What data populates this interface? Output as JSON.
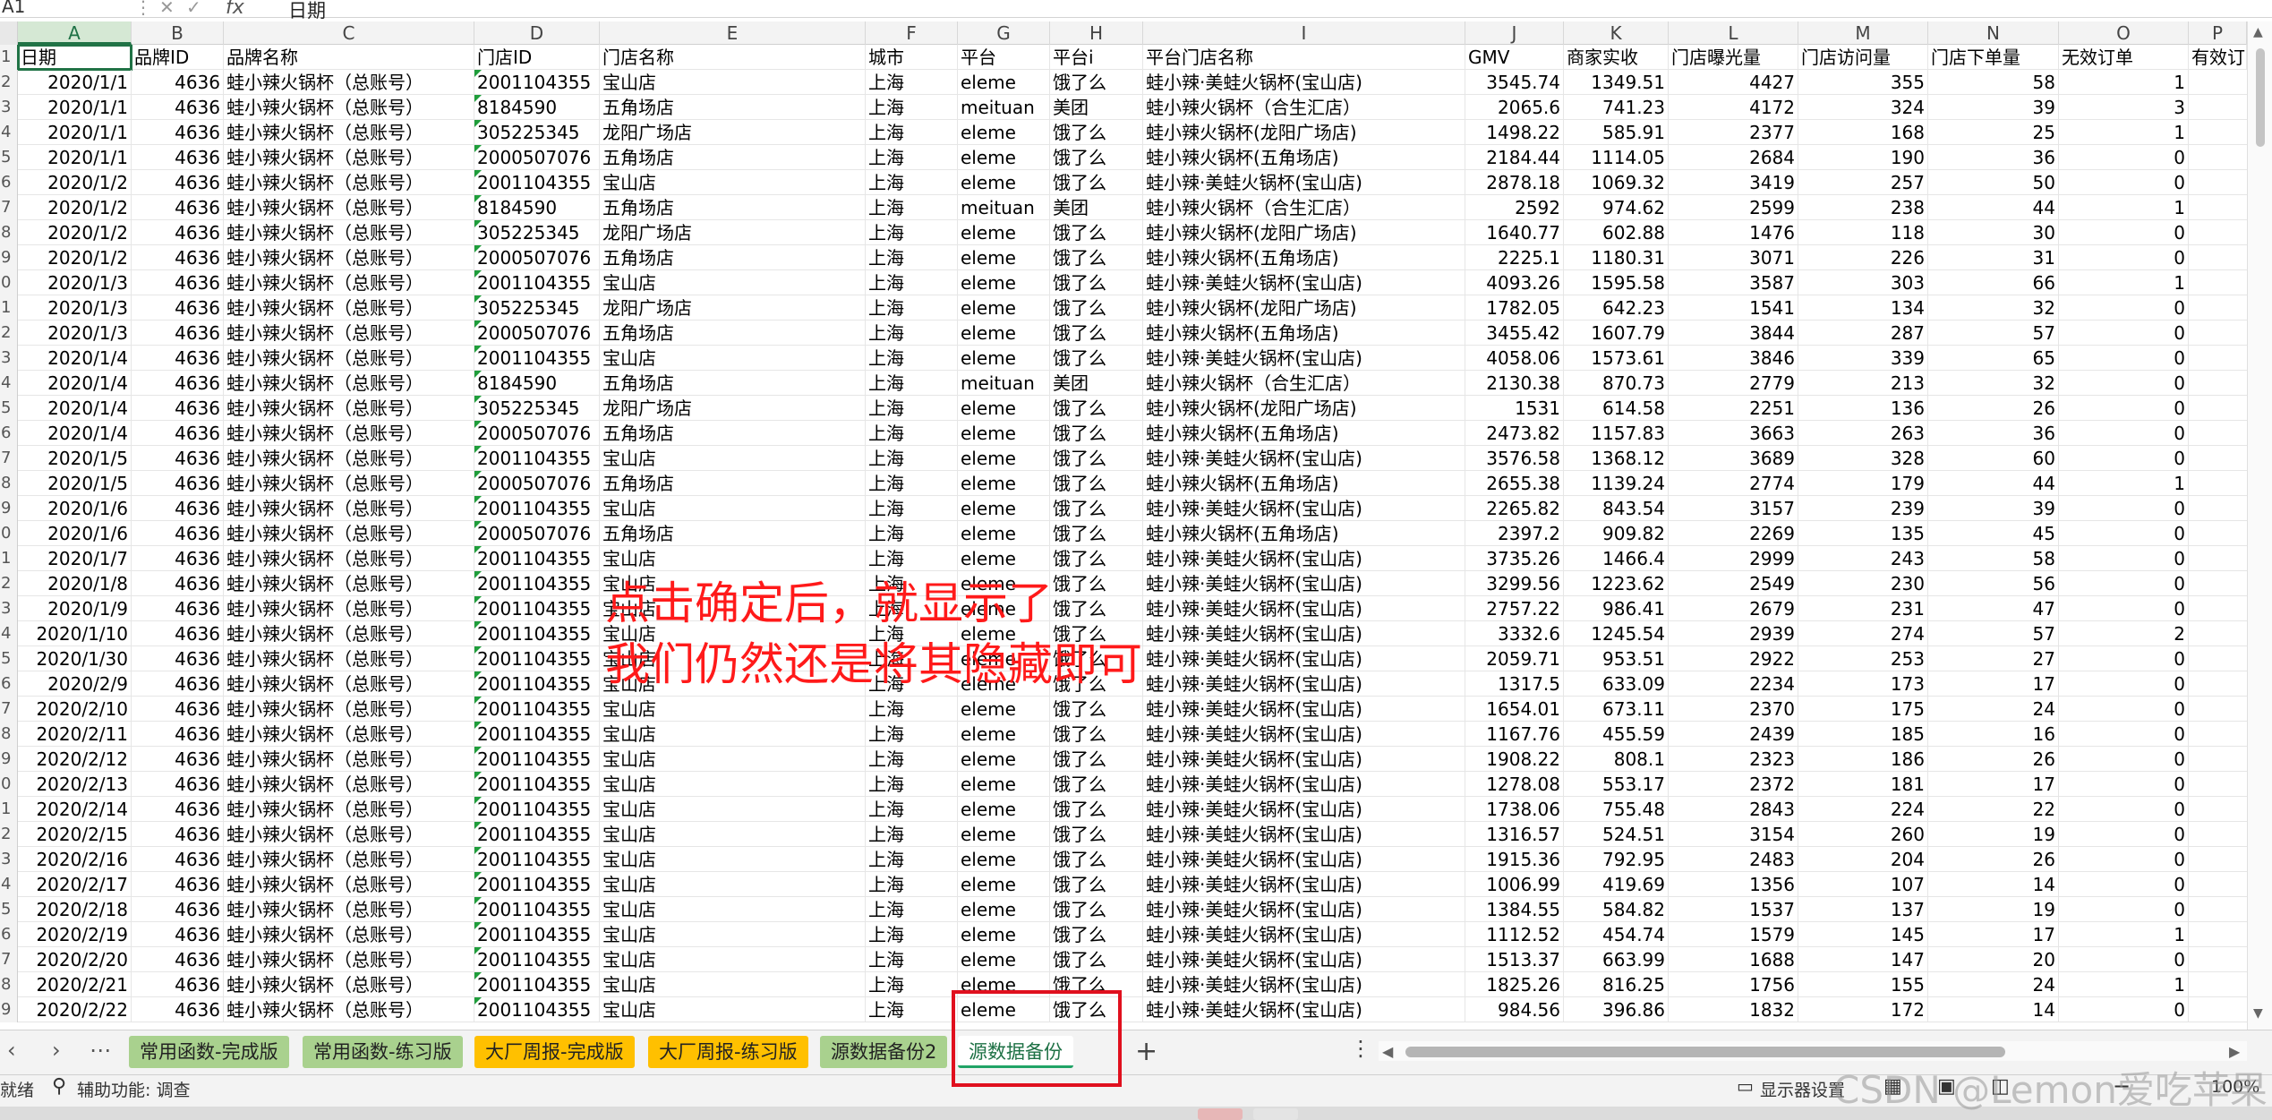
{
  "formula_bar": {
    "name_box": "A1",
    "fx": "fx",
    "content": "日期"
  },
  "columns": [
    {
      "letter": "A",
      "header": "日期"
    },
    {
      "letter": "B",
      "header": "品牌ID"
    },
    {
      "letter": "C",
      "header": "品牌名称"
    },
    {
      "letter": "D",
      "header": "门店ID"
    },
    {
      "letter": "E",
      "header": "门店名称"
    },
    {
      "letter": "F",
      "header": "城市"
    },
    {
      "letter": "G",
      "header": "平台"
    },
    {
      "letter": "H",
      "header": "平台i"
    },
    {
      "letter": "I",
      "header": "平台门店名称"
    },
    {
      "letter": "J",
      "header": "GMV"
    },
    {
      "letter": "K",
      "header": "商家实收"
    },
    {
      "letter": "L",
      "header": "门店曝光量"
    },
    {
      "letter": "M",
      "header": "门店访问量"
    },
    {
      "letter": "N",
      "header": "门店下单量"
    },
    {
      "letter": "O",
      "header": "无效订单"
    },
    {
      "letter": "P",
      "header": "有效订"
    }
  ],
  "row_numbers": [
    "1",
    "2",
    "3",
    "4",
    "5",
    "6",
    "7",
    "8",
    "9",
    "0",
    "1",
    "2",
    "3",
    "4",
    "5",
    "6",
    "7",
    "8",
    "9",
    "0",
    "1",
    "2",
    "3",
    "4",
    "5",
    "6",
    "7",
    "8",
    "9",
    "0",
    "1",
    "2",
    "3",
    "4",
    "5",
    "6",
    "7",
    "8",
    "9"
  ],
  "rows": [
    [
      "2020/1/1",
      "4636",
      "蛙小辣火锅杯（总账号）",
      "2001104355",
      "宝山店",
      "上海",
      "eleme",
      "饿了么",
      "蛙小辣·美蛙火锅杯(宝山店)",
      "3545.74",
      "1349.51",
      "4427",
      "355",
      "58",
      "1"
    ],
    [
      "2020/1/1",
      "4636",
      "蛙小辣火锅杯（总账号）",
      "8184590",
      "五角场店",
      "上海",
      "meituan",
      "美团",
      "蛙小辣火锅杯（合生汇店）",
      "2065.6",
      "741.23",
      "4172",
      "324",
      "39",
      "3"
    ],
    [
      "2020/1/1",
      "4636",
      "蛙小辣火锅杯（总账号）",
      "305225345",
      "龙阳广场店",
      "上海",
      "eleme",
      "饿了么",
      "蛙小辣火锅杯(龙阳广场店)",
      "1498.22",
      "585.91",
      "2377",
      "168",
      "25",
      "1"
    ],
    [
      "2020/1/1",
      "4636",
      "蛙小辣火锅杯（总账号）",
      "2000507076",
      "五角场店",
      "上海",
      "eleme",
      "饿了么",
      "蛙小辣火锅杯(五角场店)",
      "2184.44",
      "1114.05",
      "2684",
      "190",
      "36",
      "0"
    ],
    [
      "2020/1/2",
      "4636",
      "蛙小辣火锅杯（总账号）",
      "2001104355",
      "宝山店",
      "上海",
      "eleme",
      "饿了么",
      "蛙小辣·美蛙火锅杯(宝山店)",
      "2878.18",
      "1069.32",
      "3419",
      "257",
      "50",
      "0"
    ],
    [
      "2020/1/2",
      "4636",
      "蛙小辣火锅杯（总账号）",
      "8184590",
      "五角场店",
      "上海",
      "meituan",
      "美团",
      "蛙小辣火锅杯（合生汇店）",
      "2592",
      "974.62",
      "2599",
      "238",
      "44",
      "1"
    ],
    [
      "2020/1/2",
      "4636",
      "蛙小辣火锅杯（总账号）",
      "305225345",
      "龙阳广场店",
      "上海",
      "eleme",
      "饿了么",
      "蛙小辣火锅杯(龙阳广场店)",
      "1640.77",
      "602.88",
      "1476",
      "118",
      "30",
      "0"
    ],
    [
      "2020/1/2",
      "4636",
      "蛙小辣火锅杯（总账号）",
      "2000507076",
      "五角场店",
      "上海",
      "eleme",
      "饿了么",
      "蛙小辣火锅杯(五角场店)",
      "2225.1",
      "1180.31",
      "3071",
      "226",
      "31",
      "0"
    ],
    [
      "2020/1/3",
      "4636",
      "蛙小辣火锅杯（总账号）",
      "2001104355",
      "宝山店",
      "上海",
      "eleme",
      "饿了么",
      "蛙小辣·美蛙火锅杯(宝山店)",
      "4093.26",
      "1595.58",
      "3587",
      "303",
      "66",
      "1"
    ],
    [
      "2020/1/3",
      "4636",
      "蛙小辣火锅杯（总账号）",
      "305225345",
      "龙阳广场店",
      "上海",
      "eleme",
      "饿了么",
      "蛙小辣火锅杯(龙阳广场店)",
      "1782.05",
      "642.23",
      "1541",
      "134",
      "32",
      "0"
    ],
    [
      "2020/1/3",
      "4636",
      "蛙小辣火锅杯（总账号）",
      "2000507076",
      "五角场店",
      "上海",
      "eleme",
      "饿了么",
      "蛙小辣火锅杯(五角场店)",
      "3455.42",
      "1607.79",
      "3844",
      "287",
      "57",
      "0"
    ],
    [
      "2020/1/4",
      "4636",
      "蛙小辣火锅杯（总账号）",
      "2001104355",
      "宝山店",
      "上海",
      "eleme",
      "饿了么",
      "蛙小辣·美蛙火锅杯(宝山店)",
      "4058.06",
      "1573.61",
      "3846",
      "339",
      "65",
      "0"
    ],
    [
      "2020/1/4",
      "4636",
      "蛙小辣火锅杯（总账号）",
      "8184590",
      "五角场店",
      "上海",
      "meituan",
      "美团",
      "蛙小辣火锅杯（合生汇店）",
      "2130.38",
      "870.73",
      "2779",
      "213",
      "32",
      "0"
    ],
    [
      "2020/1/4",
      "4636",
      "蛙小辣火锅杯（总账号）",
      "305225345",
      "龙阳广场店",
      "上海",
      "eleme",
      "饿了么",
      "蛙小辣火锅杯(龙阳广场店)",
      "1531",
      "614.58",
      "2251",
      "136",
      "26",
      "0"
    ],
    [
      "2020/1/4",
      "4636",
      "蛙小辣火锅杯（总账号）",
      "2000507076",
      "五角场店",
      "上海",
      "eleme",
      "饿了么",
      "蛙小辣火锅杯(五角场店)",
      "2473.82",
      "1157.83",
      "3663",
      "263",
      "36",
      "0"
    ],
    [
      "2020/1/5",
      "4636",
      "蛙小辣火锅杯（总账号）",
      "2001104355",
      "宝山店",
      "上海",
      "eleme",
      "饿了么",
      "蛙小辣·美蛙火锅杯(宝山店)",
      "3576.58",
      "1368.12",
      "3689",
      "328",
      "60",
      "0"
    ],
    [
      "2020/1/5",
      "4636",
      "蛙小辣火锅杯（总账号）",
      "2000507076",
      "五角场店",
      "上海",
      "eleme",
      "饿了么",
      "蛙小辣火锅杯(五角场店)",
      "2655.38",
      "1139.24",
      "2774",
      "179",
      "44",
      "1"
    ],
    [
      "2020/1/6",
      "4636",
      "蛙小辣火锅杯（总账号）",
      "2001104355",
      "宝山店",
      "上海",
      "eleme",
      "饿了么",
      "蛙小辣·美蛙火锅杯(宝山店)",
      "2265.82",
      "843.54",
      "3157",
      "239",
      "39",
      "0"
    ],
    [
      "2020/1/6",
      "4636",
      "蛙小辣火锅杯（总账号）",
      "2000507076",
      "五角场店",
      "上海",
      "eleme",
      "饿了么",
      "蛙小辣火锅杯(五角场店)",
      "2397.2",
      "909.82",
      "2269",
      "135",
      "45",
      "0"
    ],
    [
      "2020/1/7",
      "4636",
      "蛙小辣火锅杯（总账号）",
      "2001104355",
      "宝山店",
      "上海",
      "eleme",
      "饿了么",
      "蛙小辣·美蛙火锅杯(宝山店)",
      "3735.26",
      "1466.4",
      "2999",
      "243",
      "58",
      "0"
    ],
    [
      "2020/1/8",
      "4636",
      "蛙小辣火锅杯（总账号）",
      "2001104355",
      "宝山店",
      "上海",
      "eleme",
      "饿了么",
      "蛙小辣·美蛙火锅杯(宝山店)",
      "3299.56",
      "1223.62",
      "2549",
      "230",
      "56",
      "0"
    ],
    [
      "2020/1/9",
      "4636",
      "蛙小辣火锅杯（总账号）",
      "2001104355",
      "宝山店",
      "上海",
      "eleme",
      "饿了么",
      "蛙小辣·美蛙火锅杯(宝山店)",
      "2757.22",
      "986.41",
      "2679",
      "231",
      "47",
      "0"
    ],
    [
      "2020/1/10",
      "4636",
      "蛙小辣火锅杯（总账号）",
      "2001104355",
      "宝山店",
      "上海",
      "eleme",
      "饿了么",
      "蛙小辣·美蛙火锅杯(宝山店)",
      "3332.6",
      "1245.54",
      "2939",
      "274",
      "57",
      "2"
    ],
    [
      "2020/1/30",
      "4636",
      "蛙小辣火锅杯（总账号）",
      "2001104355",
      "宝山店",
      "上海",
      "eleme",
      "饿了么",
      "蛙小辣·美蛙火锅杯(宝山店)",
      "2059.71",
      "953.51",
      "2922",
      "253",
      "27",
      "0"
    ],
    [
      "2020/2/9",
      "4636",
      "蛙小辣火锅杯（总账号）",
      "2001104355",
      "宝山店",
      "上海",
      "eleme",
      "饿了么",
      "蛙小辣·美蛙火锅杯(宝山店)",
      "1317.5",
      "633.09",
      "2234",
      "173",
      "17",
      "0"
    ],
    [
      "2020/2/10",
      "4636",
      "蛙小辣火锅杯（总账号）",
      "2001104355",
      "宝山店",
      "上海",
      "eleme",
      "饿了么",
      "蛙小辣·美蛙火锅杯(宝山店)",
      "1654.01",
      "673.11",
      "2370",
      "175",
      "24",
      "0"
    ],
    [
      "2020/2/11",
      "4636",
      "蛙小辣火锅杯（总账号）",
      "2001104355",
      "宝山店",
      "上海",
      "eleme",
      "饿了么",
      "蛙小辣·美蛙火锅杯(宝山店)",
      "1167.76",
      "455.59",
      "2439",
      "185",
      "16",
      "0"
    ],
    [
      "2020/2/12",
      "4636",
      "蛙小辣火锅杯（总账号）",
      "2001104355",
      "宝山店",
      "上海",
      "eleme",
      "饿了么",
      "蛙小辣·美蛙火锅杯(宝山店)",
      "1908.22",
      "808.1",
      "2323",
      "186",
      "26",
      "0"
    ],
    [
      "2020/2/13",
      "4636",
      "蛙小辣火锅杯（总账号）",
      "2001104355",
      "宝山店",
      "上海",
      "eleme",
      "饿了么",
      "蛙小辣·美蛙火锅杯(宝山店)",
      "1278.08",
      "553.17",
      "2372",
      "181",
      "17",
      "0"
    ],
    [
      "2020/2/14",
      "4636",
      "蛙小辣火锅杯（总账号）",
      "2001104355",
      "宝山店",
      "上海",
      "eleme",
      "饿了么",
      "蛙小辣·美蛙火锅杯(宝山店)",
      "1738.06",
      "755.48",
      "2843",
      "224",
      "22",
      "0"
    ],
    [
      "2020/2/15",
      "4636",
      "蛙小辣火锅杯（总账号）",
      "2001104355",
      "宝山店",
      "上海",
      "eleme",
      "饿了么",
      "蛙小辣·美蛙火锅杯(宝山店)",
      "1316.57",
      "524.51",
      "3154",
      "260",
      "19",
      "0"
    ],
    [
      "2020/2/16",
      "4636",
      "蛙小辣火锅杯（总账号）",
      "2001104355",
      "宝山店",
      "上海",
      "eleme",
      "饿了么",
      "蛙小辣·美蛙火锅杯(宝山店)",
      "1915.36",
      "792.95",
      "2483",
      "204",
      "26",
      "0"
    ],
    [
      "2020/2/17",
      "4636",
      "蛙小辣火锅杯（总账号）",
      "2001104355",
      "宝山店",
      "上海",
      "eleme",
      "饿了么",
      "蛙小辣·美蛙火锅杯(宝山店)",
      "1006.99",
      "419.69",
      "1356",
      "107",
      "14",
      "0"
    ],
    [
      "2020/2/18",
      "4636",
      "蛙小辣火锅杯（总账号）",
      "2001104355",
      "宝山店",
      "上海",
      "eleme",
      "饿了么",
      "蛙小辣·美蛙火锅杯(宝山店)",
      "1384.55",
      "584.82",
      "1537",
      "137",
      "19",
      "0"
    ],
    [
      "2020/2/19",
      "4636",
      "蛙小辣火锅杯（总账号）",
      "2001104355",
      "宝山店",
      "上海",
      "eleme",
      "饿了么",
      "蛙小辣·美蛙火锅杯(宝山店)",
      "1112.52",
      "454.74",
      "1579",
      "145",
      "17",
      "1"
    ],
    [
      "2020/2/20",
      "4636",
      "蛙小辣火锅杯（总账号）",
      "2001104355",
      "宝山店",
      "上海",
      "eleme",
      "饿了么",
      "蛙小辣·美蛙火锅杯(宝山店)",
      "1513.37",
      "663.99",
      "1688",
      "147",
      "20",
      "0"
    ],
    [
      "2020/2/21",
      "4636",
      "蛙小辣火锅杯（总账号）",
      "2001104355",
      "宝山店",
      "上海",
      "eleme",
      "饿了么",
      "蛙小辣·美蛙火锅杯(宝山店)",
      "1825.26",
      "816.25",
      "1756",
      "155",
      "24",
      "1"
    ],
    [
      "2020/2/22",
      "4636",
      "蛙小辣火锅杯（总账号）",
      "2001104355",
      "宝山店",
      "上海",
      "eleme",
      "饿了么",
      "蛙小辣·美蛙火锅杯(宝山店)",
      "984.56",
      "396.86",
      "1832",
      "172",
      "14",
      "0"
    ]
  ],
  "annotation": {
    "line1": "点击确定后，就显示了",
    "line2": "我们仍然还是将其隐藏即可"
  },
  "sheet_tabs": [
    {
      "label": "常用函数-完成版",
      "color": "green"
    },
    {
      "label": "常用函数-练习版",
      "color": "green"
    },
    {
      "label": "大厂周报-完成版",
      "color": "yellow"
    },
    {
      "label": "大厂周报-练习版",
      "color": "yellow"
    },
    {
      "label": "源数据备份2",
      "color": "green"
    },
    {
      "label": "源数据备份",
      "color": "active"
    }
  ],
  "status_bar": {
    "ready": "就绪",
    "accessibility": "辅助功能: 调查",
    "display_settings": "显示器设置",
    "zoom": "100%"
  },
  "watermark": "CSDN @Lemon爱吃苹果",
  "colors": {
    "accent": "#217346",
    "annotation": "#ff1a1a",
    "tab_green": "#a9d18e",
    "tab_yellow": "#ffc000",
    "highlight_box": "#e0101e"
  }
}
